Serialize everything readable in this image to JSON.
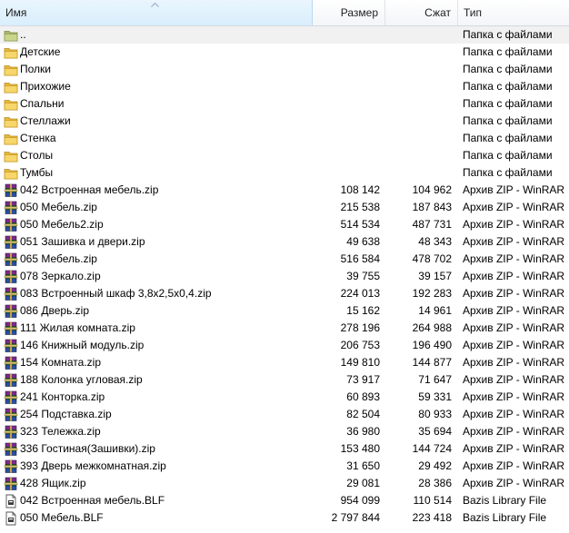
{
  "columns": {
    "name": "Имя",
    "size": "Размер",
    "packed": "Сжат",
    "type": "Тип"
  },
  "rows": [
    {
      "icon": "folder-up-icon",
      "name": "..",
      "size": "",
      "packed": "",
      "type": "Папка с файлами",
      "selected": true
    },
    {
      "icon": "folder-icon",
      "name": "Детские",
      "size": "",
      "packed": "",
      "type": "Папка с файлами"
    },
    {
      "icon": "folder-icon",
      "name": "Полки",
      "size": "",
      "packed": "",
      "type": "Папка с файлами"
    },
    {
      "icon": "folder-icon",
      "name": "Прихожие",
      "size": "",
      "packed": "",
      "type": "Папка с файлами"
    },
    {
      "icon": "folder-icon",
      "name": "Спальни",
      "size": "",
      "packed": "",
      "type": "Папка с файлами"
    },
    {
      "icon": "folder-icon",
      "name": "Стеллажи",
      "size": "",
      "packed": "",
      "type": "Папка с файлами"
    },
    {
      "icon": "folder-icon",
      "name": "Стенка",
      "size": "",
      "packed": "",
      "type": "Папка с файлами"
    },
    {
      "icon": "folder-icon",
      "name": "Столы",
      "size": "",
      "packed": "",
      "type": "Папка с файлами"
    },
    {
      "icon": "folder-icon",
      "name": "Тумбы",
      "size": "",
      "packed": "",
      "type": "Папка с файлами"
    },
    {
      "icon": "winrar-archive-icon",
      "name": "042 Встроенная мебель.zip",
      "size": "108 142",
      "packed": "104 962",
      "type": "Архив ZIP - WinRAR"
    },
    {
      "icon": "winrar-archive-icon",
      "name": "050 Мебель.zip",
      "size": "215 538",
      "packed": "187 843",
      "type": "Архив ZIP - WinRAR"
    },
    {
      "icon": "winrar-archive-icon",
      "name": "050 Мебель2.zip",
      "size": "514 534",
      "packed": "487 731",
      "type": "Архив ZIP - WinRAR"
    },
    {
      "icon": "winrar-archive-icon",
      "name": "051 Зашивка и двери.zip",
      "size": "49 638",
      "packed": "48 343",
      "type": "Архив ZIP - WinRAR"
    },
    {
      "icon": "winrar-archive-icon",
      "name": "065 Мебель.zip",
      "size": "516 584",
      "packed": "478 702",
      "type": "Архив ZIP - WinRAR"
    },
    {
      "icon": "winrar-archive-icon",
      "name": "078 Зеркало.zip",
      "size": "39 755",
      "packed": "39 157",
      "type": "Архив ZIP - WinRAR"
    },
    {
      "icon": "winrar-archive-icon",
      "name": "083 Встроенный шкаф 3,8х2,5х0,4.zip",
      "size": "224 013",
      "packed": "192 283",
      "type": "Архив ZIP - WinRAR"
    },
    {
      "icon": "winrar-archive-icon",
      "name": "086 Дверь.zip",
      "size": "15 162",
      "packed": "14 961",
      "type": "Архив ZIP - WinRAR"
    },
    {
      "icon": "winrar-archive-icon",
      "name": "111 Жилая комната.zip",
      "size": "278 196",
      "packed": "264 988",
      "type": "Архив ZIP - WinRAR"
    },
    {
      "icon": "winrar-archive-icon",
      "name": "146 Книжный модуль.zip",
      "size": "206 753",
      "packed": "196 490",
      "type": "Архив ZIP - WinRAR"
    },
    {
      "icon": "winrar-archive-icon",
      "name": "154 Комната.zip",
      "size": "149 810",
      "packed": "144 877",
      "type": "Архив ZIP - WinRAR"
    },
    {
      "icon": "winrar-archive-icon",
      "name": "188 Колонка угловая.zip",
      "size": "73 917",
      "packed": "71 647",
      "type": "Архив ZIP - WinRAR"
    },
    {
      "icon": "winrar-archive-icon",
      "name": "241 Конторка.zip",
      "size": "60 893",
      "packed": "59 331",
      "type": "Архив ZIP - WinRAR"
    },
    {
      "icon": "winrar-archive-icon",
      "name": "254 Подставка.zip",
      "size": "82 504",
      "packed": "80 933",
      "type": "Архив ZIP - WinRAR"
    },
    {
      "icon": "winrar-archive-icon",
      "name": "323 Тележка.zip",
      "size": "36 980",
      "packed": "35 694",
      "type": "Архив ZIP - WinRAR"
    },
    {
      "icon": "winrar-archive-icon",
      "name": "336 Гостиная(Зашивки).zip",
      "size": "153 480",
      "packed": "144 724",
      "type": "Архив ZIP - WinRAR"
    },
    {
      "icon": "winrar-archive-icon",
      "name": "393 Дверь межкомнатная.zip",
      "size": "31 650",
      "packed": "29 492",
      "type": "Архив ZIP - WinRAR"
    },
    {
      "icon": "winrar-archive-icon",
      "name": "428 Ящик.zip",
      "size": "29 081",
      "packed": "28 386",
      "type": "Архив ZIP - WinRAR"
    },
    {
      "icon": "bazis-file-icon",
      "name": "042 Встроенная мебель.BLF",
      "size": "954 099",
      "packed": "110 514",
      "type": "Bazis Library File"
    },
    {
      "icon": "bazis-file-icon",
      "name": "050 Мебель.BLF",
      "size": "2 797 844",
      "packed": "223 418",
      "type": "Bazis Library File"
    }
  ]
}
